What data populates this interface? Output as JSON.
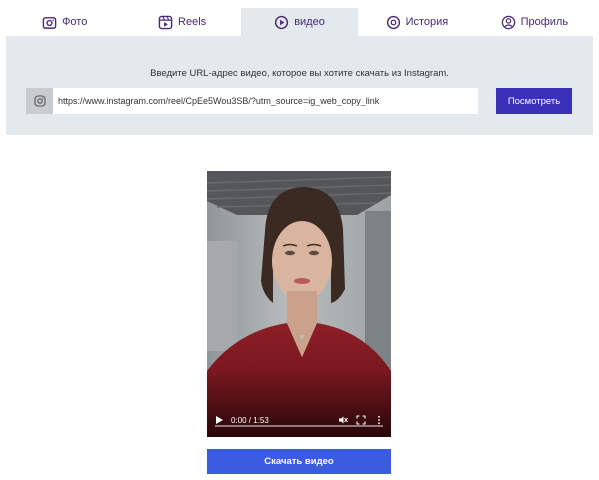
{
  "tabs": [
    {
      "label": "Фото",
      "icon": "camera-icon"
    },
    {
      "label": "Reels",
      "icon": "reels-icon"
    },
    {
      "label": "видео",
      "icon": "play-circle-icon"
    },
    {
      "label": "История",
      "icon": "story-icon"
    },
    {
      "label": "Профиль",
      "icon": "profile-icon"
    }
  ],
  "active_tab": "видео",
  "form": {
    "prompt": "Введите URL-адрес видео, которое вы хотите скачать из Instagram.",
    "url_value": "https://www.instagram.com/reel/CpEe5Wou3SB/?utm_source=ig_web_copy_link",
    "input_icon": "instagram-icon",
    "view_button": "Посмотреть"
  },
  "player": {
    "time": "0:00 / 1:53",
    "progress": 0
  },
  "download_button": "Скачать видео",
  "colors": {
    "accent_purple": "#3b30b8",
    "download_blue": "#3b5be0",
    "tab_text": "#4a2a75",
    "panel_bg": "#e3e9ec"
  }
}
